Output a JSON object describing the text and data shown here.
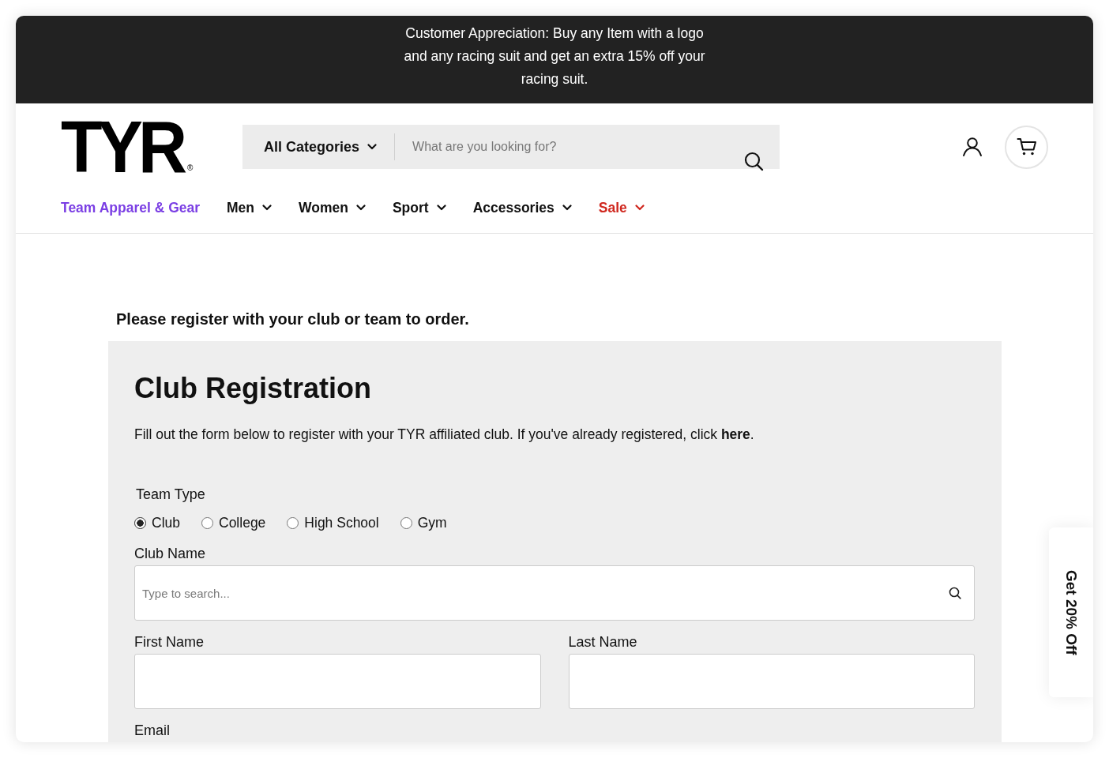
{
  "announcement": {
    "text": "Customer Appreciation: Buy any Item with a logo and any racing suit and get an extra 15% off your racing suit."
  },
  "header": {
    "logo": {
      "text": "TYR",
      "mark": "®"
    },
    "search": {
      "category": "All Categories",
      "placeholder": "What are you looking for?"
    }
  },
  "nav": [
    {
      "label": "Team Apparel & Gear",
      "color": "#7b3fe4",
      "has_menu": false
    },
    {
      "label": "Men",
      "color": "#111111",
      "has_menu": true
    },
    {
      "label": "Women",
      "color": "#111111",
      "has_menu": true
    },
    {
      "label": "Sport",
      "color": "#111111",
      "has_menu": true
    },
    {
      "label": "Accessories",
      "color": "#111111",
      "has_menu": true
    },
    {
      "label": "Sale",
      "color": "#d0281f",
      "has_menu": true
    }
  ],
  "notice": "Please register with your club or team to order.",
  "registration": {
    "title": "Club Registration",
    "intro": {
      "text": "Fill out the form below to register with your TYR affiliated club. If you've already registered, click ",
      "link": "here",
      "after": "."
    },
    "team_type": {
      "label": "Team Type",
      "options": [
        {
          "label": "Club",
          "selected": true
        },
        {
          "label": "College",
          "selected": false
        },
        {
          "label": "High School",
          "selected": false
        },
        {
          "label": "Gym",
          "selected": false
        }
      ]
    },
    "rows": [
      [
        {
          "label": "Club Name",
          "kind": "search",
          "placeholder": "Type to search..."
        }
      ],
      [
        {
          "label": "First Name",
          "kind": "text"
        },
        {
          "label": "Last Name",
          "kind": "text"
        }
      ],
      [
        {
          "label": "Email",
          "kind": "label"
        }
      ]
    ]
  },
  "promo_tab": {
    "text": "Get 20% Off"
  }
}
